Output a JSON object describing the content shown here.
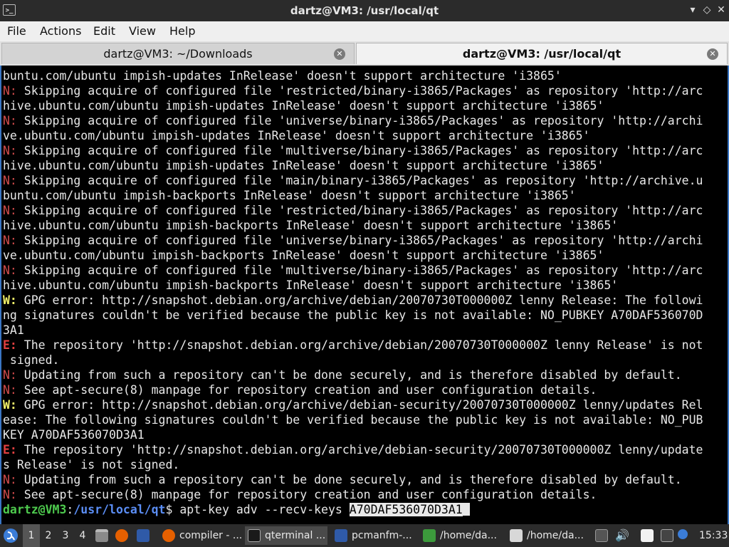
{
  "window": {
    "title": "dartz@VM3: /usr/local/qt",
    "app_icon": ">_",
    "minimize": "▾",
    "maximize": "◇",
    "close": "✕"
  },
  "menu": [
    "File",
    "Actions",
    "Edit",
    "View",
    "Help"
  ],
  "tabs": [
    {
      "label": "dartz@VM3: ~/Downloads",
      "active": false
    },
    {
      "label": "dartz@VM3: /usr/local/qt",
      "active": true
    }
  ],
  "terminal": {
    "lines": [
      {
        "prefix": "",
        "kind": "",
        "text": "buntu.com/ubuntu impish-updates InRelease' doesn't support architecture 'i3865'"
      },
      {
        "prefix": "N:",
        "kind": "n",
        "text": " Skipping acquire of configured file 'restricted/binary-i3865/Packages' as repository 'http://arc"
      },
      {
        "prefix": "",
        "kind": "",
        "text": "hive.ubuntu.com/ubuntu impish-updates InRelease' doesn't support architecture 'i3865'"
      },
      {
        "prefix": "N:",
        "kind": "n",
        "text": " Skipping acquire of configured file 'universe/binary-i3865/Packages' as repository 'http://archi"
      },
      {
        "prefix": "",
        "kind": "",
        "text": "ve.ubuntu.com/ubuntu impish-updates InRelease' doesn't support architecture 'i3865'"
      },
      {
        "prefix": "N:",
        "kind": "n",
        "text": " Skipping acquire of configured file 'multiverse/binary-i3865/Packages' as repository 'http://arc"
      },
      {
        "prefix": "",
        "kind": "",
        "text": "hive.ubuntu.com/ubuntu impish-updates InRelease' doesn't support architecture 'i3865'"
      },
      {
        "prefix": "N:",
        "kind": "n",
        "text": " Skipping acquire of configured file 'main/binary-i3865/Packages' as repository 'http://archive.u"
      },
      {
        "prefix": "",
        "kind": "",
        "text": "buntu.com/ubuntu impish-backports InRelease' doesn't support architecture 'i3865'"
      },
      {
        "prefix": "N:",
        "kind": "n",
        "text": " Skipping acquire of configured file 'restricted/binary-i3865/Packages' as repository 'http://arc"
      },
      {
        "prefix": "",
        "kind": "",
        "text": "hive.ubuntu.com/ubuntu impish-backports InRelease' doesn't support architecture 'i3865'"
      },
      {
        "prefix": "N:",
        "kind": "n",
        "text": " Skipping acquire of configured file 'universe/binary-i3865/Packages' as repository 'http://archi"
      },
      {
        "prefix": "",
        "kind": "",
        "text": "ve.ubuntu.com/ubuntu impish-backports InRelease' doesn't support architecture 'i3865'"
      },
      {
        "prefix": "N:",
        "kind": "n",
        "text": " Skipping acquire of configured file 'multiverse/binary-i3865/Packages' as repository 'http://arc"
      },
      {
        "prefix": "",
        "kind": "",
        "text": "hive.ubuntu.com/ubuntu impish-backports InRelease' doesn't support architecture 'i3865'"
      },
      {
        "prefix": "W:",
        "kind": "w",
        "text": " GPG error: http://snapshot.debian.org/archive/debian/20070730T000000Z lenny Release: The followi"
      },
      {
        "prefix": "",
        "kind": "",
        "text": "ng signatures couldn't be verified because the public key is not available: NO_PUBKEY A70DAF536070D"
      },
      {
        "prefix": "",
        "kind": "",
        "text": "3A1"
      },
      {
        "prefix": "E:",
        "kind": "e",
        "text": " The repository 'http://snapshot.debian.org/archive/debian/20070730T000000Z lenny Release' is not"
      },
      {
        "prefix": "",
        "kind": "",
        "text": " signed."
      },
      {
        "prefix": "N:",
        "kind": "n",
        "text": " Updating from such a repository can't be done securely, and is therefore disabled by default."
      },
      {
        "prefix": "N:",
        "kind": "n",
        "text": " See apt-secure(8) manpage for repository creation and user configuration details."
      },
      {
        "prefix": "W:",
        "kind": "w",
        "text": " GPG error: http://snapshot.debian.org/archive/debian-security/20070730T000000Z lenny/updates Rel"
      },
      {
        "prefix": "",
        "kind": "",
        "text": "ease: The following signatures couldn't be verified because the public key is not available: NO_PUB"
      },
      {
        "prefix": "",
        "kind": "",
        "text": "KEY A70DAF536070D3A1"
      },
      {
        "prefix": "E:",
        "kind": "e",
        "text": " The repository 'http://snapshot.debian.org/archive/debian-security/20070730T000000Z lenny/update"
      },
      {
        "prefix": "",
        "kind": "",
        "text": "s Release' is not signed."
      },
      {
        "prefix": "N:",
        "kind": "n",
        "text": " Updating from such a repository can't be done securely, and is therefore disabled by default."
      },
      {
        "prefix": "N:",
        "kind": "n",
        "text": " See apt-secure(8) manpage for repository creation and user configuration details."
      }
    ],
    "prompt": {
      "user": "dartz@VM3",
      "sep": ":",
      "path": "/usr/local/qt",
      "dollar": "$ ",
      "command": "apt-key adv --recv-keys ",
      "selected": "A70DAF536070D3A1"
    }
  },
  "taskbar": {
    "workspaces": [
      "1",
      "2",
      "3",
      "4"
    ],
    "current_workspace": "1",
    "buttons": [
      {
        "label": "compiler - ...",
        "icon": "firefox-icon"
      },
      {
        "label": "qterminal ...",
        "icon": "terminal-icon"
      },
      {
        "label": "pcmanfm-...",
        "icon": "folder-icon"
      },
      {
        "label": "/home/da...",
        "icon": "file-icon"
      },
      {
        "label": "/home/da...",
        "icon": "editor-icon"
      }
    ],
    "clock": "15:33"
  },
  "colors": {
    "accent": "#3a76c4",
    "user": "#4ecb4e",
    "path": "#5b8ef5",
    "warn": "#f4f36a",
    "error": "#e34040",
    "note": "#d14b4b"
  }
}
